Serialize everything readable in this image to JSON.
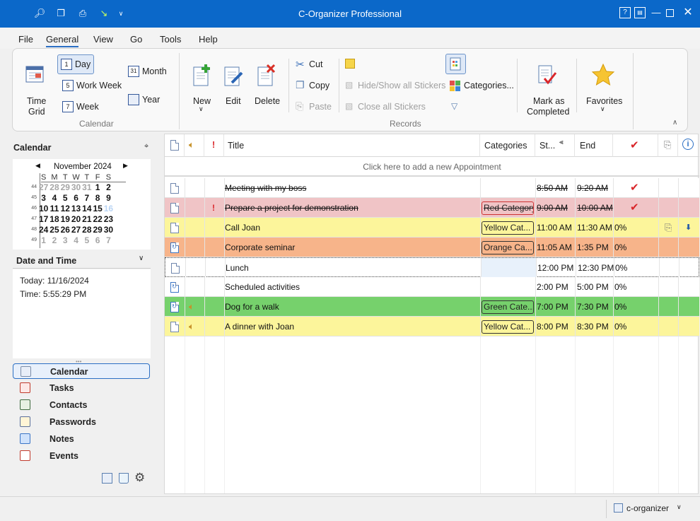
{
  "window": {
    "title": "C-Organizer Professional"
  },
  "menu": [
    "File",
    "General",
    "View",
    "Go",
    "Tools",
    "Help"
  ],
  "ribbon": {
    "calendar_group": {
      "label": "Calendar",
      "time_grid": "Time\nGrid",
      "time_grid_line1": "Time",
      "time_grid_line2": "Grid",
      "day": "Day",
      "work_week": "Work Week",
      "week": "Week",
      "month": "Month",
      "year": "Year"
    },
    "records_group": {
      "label": "Records",
      "new": "New",
      "edit": "Edit",
      "delete": "Delete",
      "cut": "Cut",
      "copy": "Copy",
      "paste": "Paste",
      "hide_show_stickers": "Hide/Show all Stickers",
      "close_stickers": "Close all Stickers",
      "categories": "Categories...",
      "mark_completed_line1": "Mark as",
      "mark_completed_line2": "Completed",
      "favorites": "Favorites"
    }
  },
  "left": {
    "calendar_title": "Calendar",
    "month_label": "November 2024",
    "weekdays": [
      "S",
      "M",
      "T",
      "W",
      "T",
      "F",
      "S"
    ],
    "weeks": [
      {
        "wk": "44",
        "days": [
          {
            "d": "27",
            "dim": true
          },
          {
            "d": "28",
            "dim": true
          },
          {
            "d": "29",
            "dim": true
          },
          {
            "d": "30",
            "dim": true
          },
          {
            "d": "31",
            "dim": true
          },
          {
            "d": "1"
          },
          {
            "d": "2"
          }
        ]
      },
      {
        "wk": "45",
        "days": [
          {
            "d": "3"
          },
          {
            "d": "4"
          },
          {
            "d": "5"
          },
          {
            "d": "6"
          },
          {
            "d": "7"
          },
          {
            "d": "8"
          },
          {
            "d": "9"
          }
        ]
      },
      {
        "wk": "46",
        "days": [
          {
            "d": "10"
          },
          {
            "d": "11"
          },
          {
            "d": "12"
          },
          {
            "d": "13"
          },
          {
            "d": "14"
          },
          {
            "d": "15"
          },
          {
            "d": "16",
            "today": true
          }
        ]
      },
      {
        "wk": "47",
        "days": [
          {
            "d": "17"
          },
          {
            "d": "18"
          },
          {
            "d": "19"
          },
          {
            "d": "20"
          },
          {
            "d": "21"
          },
          {
            "d": "22"
          },
          {
            "d": "23"
          }
        ]
      },
      {
        "wk": "48",
        "days": [
          {
            "d": "24"
          },
          {
            "d": "25"
          },
          {
            "d": "26"
          },
          {
            "d": "27"
          },
          {
            "d": "28"
          },
          {
            "d": "29"
          },
          {
            "d": "30"
          }
        ]
      },
      {
        "wk": "49",
        "days": [
          {
            "d": "1",
            "dim": true
          },
          {
            "d": "2",
            "dim": true
          },
          {
            "d": "3",
            "dim": true
          },
          {
            "d": "4",
            "dim": true
          },
          {
            "d": "5",
            "dim": true
          },
          {
            "d": "6",
            "dim": true
          },
          {
            "d": "7",
            "dim": true
          }
        ]
      }
    ],
    "date_time_title": "Date and Time",
    "today_text": "Today: 11/16/2024",
    "time_text": "Time: 5:55:29 PM",
    "nav": [
      "Calendar",
      "Tasks",
      "Contacts",
      "Passwords",
      "Notes",
      "Events"
    ]
  },
  "grid": {
    "headers": {
      "title": "Title",
      "categories": "Categories",
      "start": "St...",
      "end": "End"
    },
    "add_new_text": "Click here to add a new Appointment",
    "rows": [
      {
        "title": "Meeting with my boss",
        "category": "",
        "start": "8:50 AM",
        "end": "9:20 AM",
        "progress": "",
        "done": true,
        "strike": true,
        "bg": "#ffffff",
        "important": false,
        "recur": false,
        "sound": false,
        "attach": false,
        "more": false,
        "catcolor": ""
      },
      {
        "title": "Prepare a project for demonstration",
        "category": "Red Category",
        "start": "9:00 AM",
        "end": "10:00 AM",
        "progress": "",
        "done": true,
        "strike": true,
        "bg": "#f0c4c6",
        "important": true,
        "recur": false,
        "sound": false,
        "attach": false,
        "more": false,
        "catcolor": "#f0c4c6"
      },
      {
        "title": "Call Joan",
        "category": "Yellow Cat...",
        "start": "11:00 AM",
        "end": "11:30 AM",
        "progress": "0%",
        "done": false,
        "strike": false,
        "bg": "#fcf59b",
        "important": false,
        "recur": false,
        "sound": false,
        "attach": true,
        "more": true,
        "catcolor": "#fcf59b"
      },
      {
        "title": "Corporate seminar",
        "category": "Orange Ca...",
        "start": "11:05 AM",
        "end": "1:35 PM",
        "progress": "0%",
        "done": false,
        "strike": false,
        "bg": "#f7b48a",
        "important": false,
        "recur": true,
        "sound": false,
        "attach": false,
        "more": false,
        "catcolor": "#f7b48a"
      },
      {
        "title": "Lunch",
        "category": "",
        "start": "12:00 PM",
        "end": "12:30 PM",
        "progress": "0%",
        "done": false,
        "strike": false,
        "bg": "#ffffff",
        "important": false,
        "recur": false,
        "sound": false,
        "attach": false,
        "more": false,
        "catcolor": "",
        "selected": true
      },
      {
        "title": "Scheduled activities",
        "category": "",
        "start": "2:00 PM",
        "end": "5:00 PM",
        "progress": "0%",
        "done": false,
        "strike": false,
        "bg": "#ffffff",
        "important": false,
        "recur": true,
        "sound": false,
        "attach": false,
        "more": false,
        "catcolor": ""
      },
      {
        "title": "Dog for a walk",
        "category": "Green Cate...",
        "start": "7:00 PM",
        "end": "7:30 PM",
        "progress": "0%",
        "done": false,
        "strike": false,
        "bg": "#76d16c",
        "important": false,
        "recur": true,
        "sound": true,
        "attach": false,
        "more": false,
        "catcolor": "#76d16c"
      },
      {
        "title": "A dinner with Joan",
        "category": "Yellow Cat...",
        "start": "8:00 PM",
        "end": "8:30 PM",
        "progress": "0%",
        "done": false,
        "strike": false,
        "bg": "#fcf59b",
        "important": false,
        "recur": false,
        "sound": true,
        "attach": false,
        "more": false,
        "catcolor": "#fcf59b"
      }
    ]
  },
  "status": {
    "user": "c-organizer"
  },
  "colors": {
    "titlebar": "#0b68c9",
    "accent": "#2b6fc4",
    "check": "#d9262a"
  }
}
